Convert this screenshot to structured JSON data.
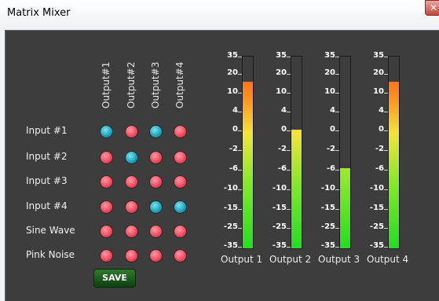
{
  "window": {
    "title": "Matrix Mixer",
    "close_icon": "close-icon"
  },
  "outputs": [
    "Output#1",
    "Output#2",
    "Output#3",
    "Output#4"
  ],
  "inputs": [
    "Input #1",
    "Input #2",
    "Input #3",
    "Input #4",
    "Sine Wave",
    "Pink Noise"
  ],
  "matrix": [
    [
      true,
      false,
      true,
      false
    ],
    [
      false,
      true,
      false,
      false
    ],
    [
      false,
      false,
      false,
      false
    ],
    [
      false,
      false,
      true,
      true
    ],
    [
      false,
      false,
      false,
      false
    ],
    [
      false,
      false,
      false,
      false
    ]
  ],
  "save_label": "SAVE",
  "meter_scale": [
    "35",
    "20",
    "10",
    "4",
    "0",
    "-2",
    "-6",
    "-10",
    "-15",
    "-25",
    "-35"
  ],
  "meters": [
    {
      "label": "Output 1",
      "level": 0.87
    },
    {
      "label": "Output 2",
      "level": 0.62
    },
    {
      "label": "Output 3",
      "level": 0.42
    },
    {
      "label": "Output 4",
      "level": 0.87
    }
  ],
  "colors": {
    "on": "#18a2bd",
    "off": "#f2475a",
    "panel": "#3d3d3d"
  }
}
